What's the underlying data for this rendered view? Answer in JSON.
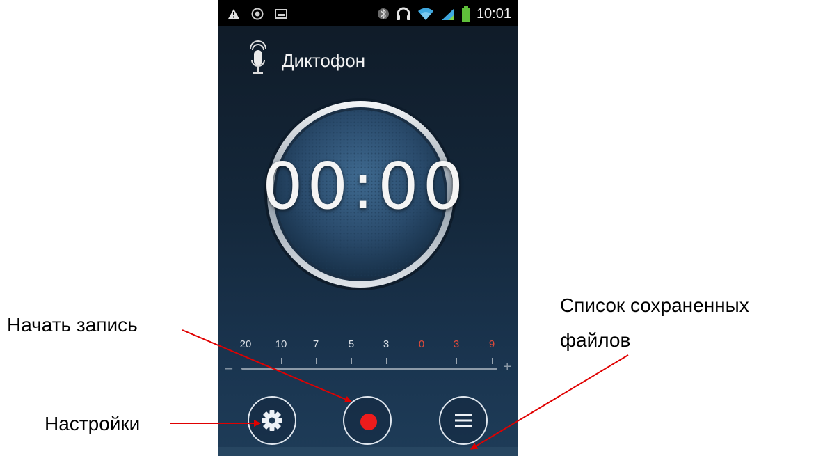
{
  "status_bar": {
    "time": "10:01",
    "icons": [
      "warning-icon",
      "cat-icon",
      "image-icon",
      "bluetooth-icon",
      "headphones-icon",
      "wifi-icon",
      "signal-icon",
      "battery-icon"
    ]
  },
  "app": {
    "title": "Диктофон",
    "icon": "microphone-icon"
  },
  "timer": {
    "value": "00:00"
  },
  "level_scale": {
    "labels": [
      "20",
      "10",
      "7",
      "5",
      "3",
      "0",
      "3",
      "9"
    ],
    "red_from_index": 5,
    "minus": "–",
    "plus": "+"
  },
  "controls": {
    "settings": "gear-icon",
    "record": "record-icon",
    "list": "list-icon"
  },
  "annotations": {
    "start_record": "Начать запись",
    "settings": "Настройки",
    "saved_files_line1": "Список сохраненных",
    "saved_files_line2": "файлов"
  },
  "colors": {
    "record_red": "#ee1c1c",
    "arrow_red": "#e00000",
    "scale_red": "#e04a3a"
  }
}
